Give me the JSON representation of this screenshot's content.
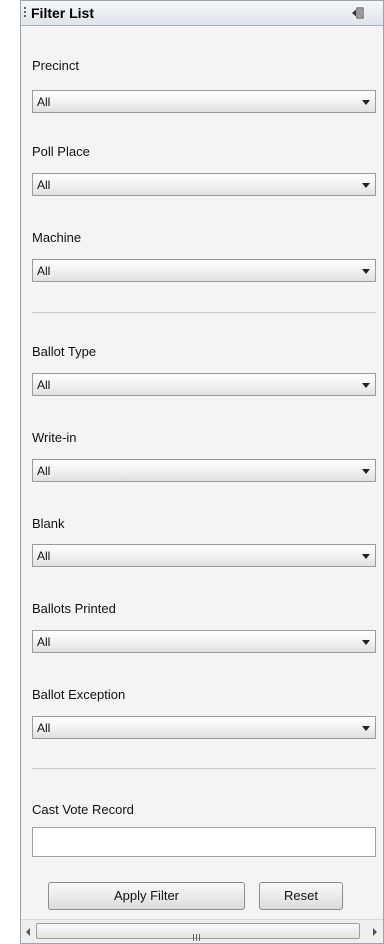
{
  "panel": {
    "title": "Filter List",
    "collapse_icon": "collapse-panel-icon"
  },
  "filters": {
    "precinct": {
      "label": "Precinct",
      "value": "All"
    },
    "poll_place": {
      "label": "Poll Place",
      "value": "All"
    },
    "machine": {
      "label": "Machine",
      "value": "All"
    },
    "ballot_type": {
      "label": "Ballot Type",
      "value": "All"
    },
    "write_in": {
      "label": "Write-in",
      "value": "All"
    },
    "blank": {
      "label": "Blank",
      "value": "All"
    },
    "ballots_printed": {
      "label": "Ballots Printed",
      "value": "All"
    },
    "ballot_exception": {
      "label": "Ballot Exception",
      "value": "All"
    }
  },
  "cast_vote_record": {
    "label": "Cast Vote Record",
    "value": ""
  },
  "buttons": {
    "apply": "Apply Filter",
    "reset": "Reset"
  },
  "scrollbar": {
    "grip_icon": "scroll-grip-icon"
  }
}
